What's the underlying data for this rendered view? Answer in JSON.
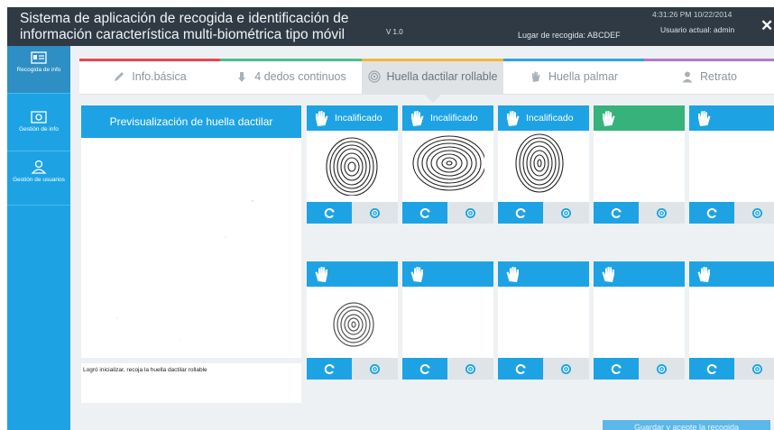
{
  "window": {
    "title": "Sistema de aplicación de recogida e identificación de información característica multi-biométrica tipo móvil",
    "version": "V 1.0",
    "location": "Lugar de recogida: ABCDEF",
    "datetime": "4:31:26 PM 10/22/2014",
    "user": "Usuario actual: admin",
    "close_label": "✕"
  },
  "sidebar": {
    "items": [
      {
        "label": "Recogida de info",
        "icon": "id-card-icon",
        "active": true
      },
      {
        "label": "Gestión de info",
        "icon": "document-icon",
        "active": false
      },
      {
        "label": "Gestión de usuarios",
        "icon": "user-icon",
        "active": false
      }
    ]
  },
  "tabs": [
    {
      "label": "Info.básica",
      "icon": "pencil-icon",
      "color": "#e8474f",
      "active": false
    },
    {
      "label": "4 dedos continuos",
      "icon": "hand-down-icon",
      "color": "#4cbf8a",
      "active": false
    },
    {
      "label": "Huella dactilar rollable",
      "icon": "fingerprint-icon",
      "color": "#f3b73a",
      "active": true
    },
    {
      "label": "Huella palmar",
      "icon": "palm-icon",
      "color": "#2fa3e0",
      "active": false
    },
    {
      "label": "Retrato",
      "icon": "portrait-icon",
      "color": "#b17ad2",
      "active": false
    }
  ],
  "preview": {
    "title": "Previsualización de huella dactilar",
    "status": "Logró inicializar, recoja la huella dactilar rollable"
  },
  "fingers": [
    {
      "status": "Incalificado",
      "head_color": "#1da3e4",
      "print": "right-1"
    },
    {
      "status": "Incalificado",
      "head_color": "#1da3e4",
      "print": "right-2"
    },
    {
      "status": "Incalificado",
      "head_color": "#1da3e4",
      "print": "right-3"
    },
    {
      "status": "",
      "head_color": "#36b27a",
      "print": ""
    },
    {
      "status": "",
      "head_color": "#1da3e4",
      "print": ""
    },
    {
      "status": "",
      "head_color": "#1da3e4",
      "print": "left-1"
    },
    {
      "status": "",
      "head_color": "#1da3e4",
      "print": ""
    },
    {
      "status": "",
      "head_color": "#1da3e4",
      "print": ""
    },
    {
      "status": "",
      "head_color": "#1da3e4",
      "print": ""
    },
    {
      "status": "",
      "head_color": "#1da3e4",
      "print": ""
    }
  ],
  "footer": {
    "save_label": "Guardar y acepte la recogida"
  }
}
